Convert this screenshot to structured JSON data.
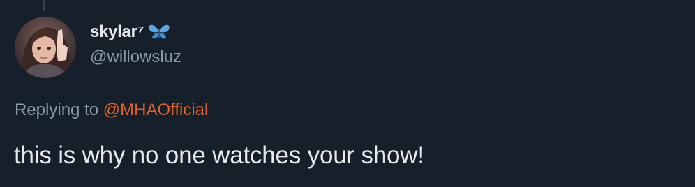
{
  "tweet": {
    "display_name": "skylar⁷",
    "badge_icon": "butterfly-icon",
    "handle": "@willowsluz",
    "replying_prefix": "Replying to ",
    "replying_to": "@MHAOfficial",
    "text": "this is why no one watches your show!"
  },
  "colors": {
    "background": "#15202b",
    "primary_text": "#e7e9ea",
    "secondary_text": "#8b98a5",
    "mention": "#e0612a",
    "butterfly": "#5aa9e6"
  }
}
